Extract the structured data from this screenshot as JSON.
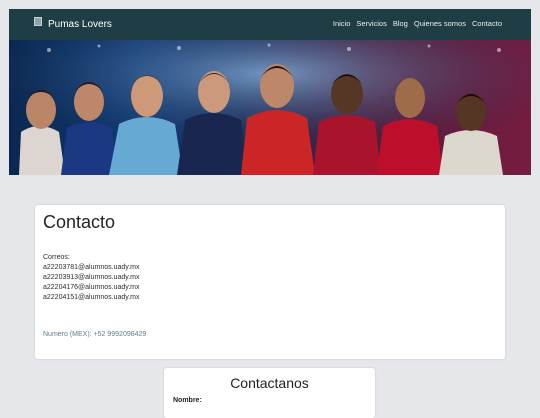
{
  "navbar": {
    "brand": "Pumas Lovers",
    "links": [
      "Inicio",
      "Servicios",
      "Blog",
      "Quienes somos",
      "Contacto"
    ]
  },
  "hero": {
    "image": "football-players-banner"
  },
  "contact": {
    "title": "Contacto",
    "emails_label": "Correos:",
    "emails": [
      "a22203781@alumnos.uady.mx",
      "a22203913@alumnos.uady.mx",
      "a22204176@alumnos.uady.mx",
      "a22204151@alumnos.uady.mx"
    ],
    "phone": "Numero (MEX): +52 9992098429"
  },
  "form": {
    "title": "Contactanos",
    "name_label": "Nombre:"
  },
  "colors": {
    "navbar": "#1f3d44",
    "page_bg": "#e5e7eb",
    "phone_text": "#5c7d8c"
  }
}
